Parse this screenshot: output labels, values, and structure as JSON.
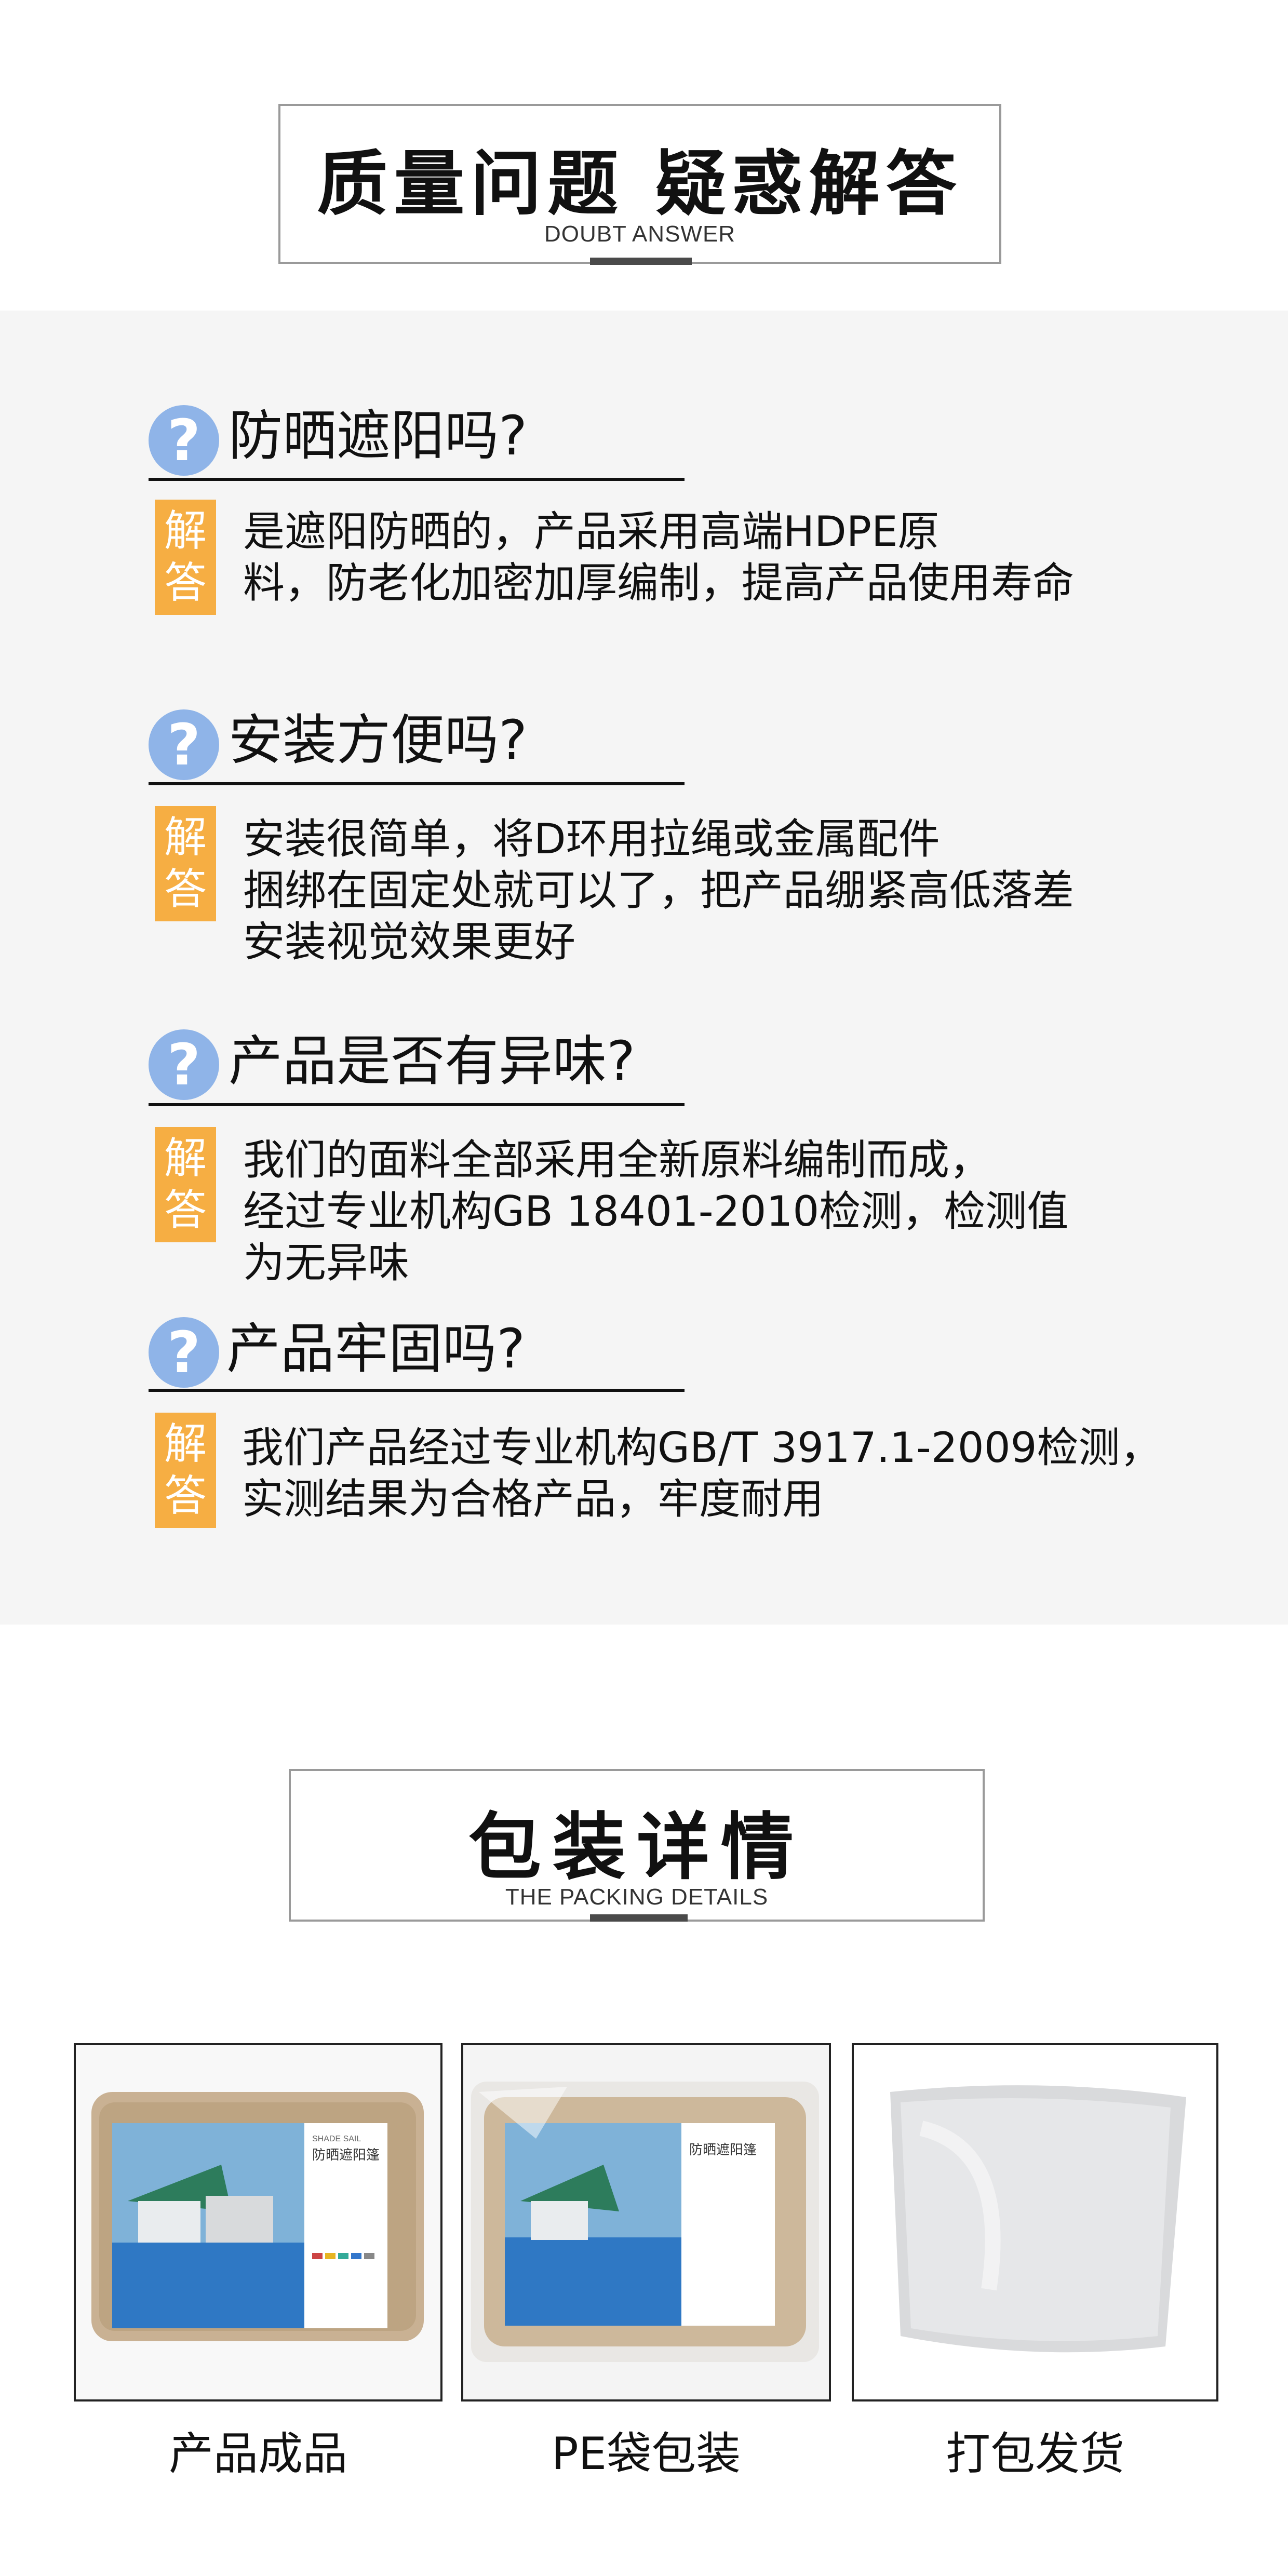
{
  "doubt": {
    "title": "质量问题 疑惑解答",
    "subtitle": "DOUBT ANSWER"
  },
  "faq": [
    {
      "question": "防晒遮阳吗?",
      "badge": [
        "解",
        "答"
      ],
      "answer": "是遮阳防晒的，产品采用高端HDPE原\n料，防老化加密加厚编制，提高产品使用寿命"
    },
    {
      "question": "安装方便吗?",
      "badge": [
        "解",
        "答"
      ],
      "answer": "安装很简单，将D环用拉绳或金属配件\n捆绑在固定处就可以了，把产品绷紧高低落差\n安装视觉效果更好"
    },
    {
      "question": "产品是否有异味?",
      "badge": [
        "解",
        "答"
      ],
      "answer": "我们的面料全部采用全新原料编制而成，\n经过专业机构GB 18401-2010检测，检测值\n为无异味"
    },
    {
      "question": "产品牢固吗?",
      "badge": [
        "解",
        "答"
      ],
      "answer": "我们产品经过专业机构GB/T 3917.1-2009检测，\n实测结果为合格产品，牢度耐用"
    }
  ],
  "q_mark": "?",
  "packing": {
    "title": "包装详情",
    "subtitle": "THE PACKING DETAILS"
  },
  "product_label": {
    "brand": "SHADE SAIL",
    "name": "防晒遮阳篷"
  },
  "pictures": [
    {
      "caption": "产品成品"
    },
    {
      "caption": "PE袋包装"
    },
    {
      "caption": "打包发货"
    }
  ],
  "colors": {
    "question_icon": "#8fb4e8",
    "answer_badge": "#f6ae43",
    "band_background": "#f5f5f5"
  }
}
